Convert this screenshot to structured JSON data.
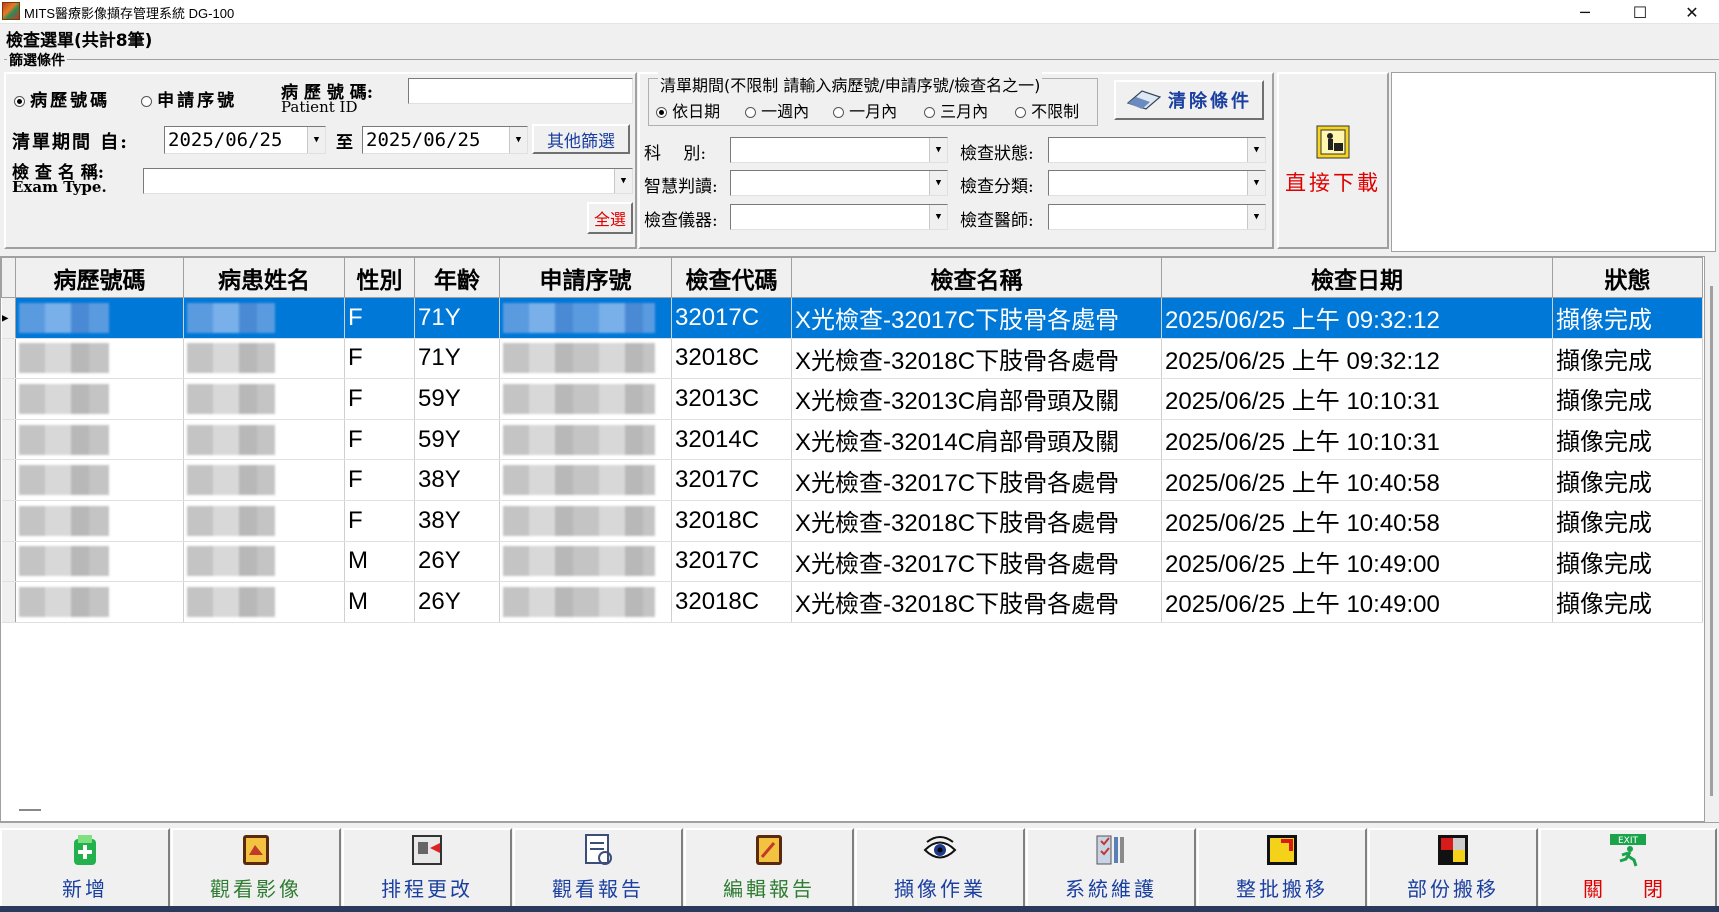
{
  "window": {
    "title": "MITS醫療影像擷存管理系統 DG-100",
    "minimize": "─",
    "maximize": "☐",
    "close": "✕"
  },
  "list_title": "檢查選單(共計8筆)",
  "filter": {
    "group_label": "篩選條件",
    "radio_patient": "病歷號碼",
    "radio_request": "申請序號",
    "patient_label": "病 歷 號 碼:",
    "patient_label_en": "Patient ID",
    "patient_value": "",
    "period_label": "清單期間 自:",
    "date_from": "2025/06/25",
    "to_label": "至",
    "date_to": "2025/06/25",
    "other_filter": "其他篩選",
    "exam_name_label": "檢 查 名 稱:",
    "exam_name_en": "Exam Type.",
    "exam_name_value": "",
    "select_all": "全選",
    "period_group_label": "清單期間(不限制 請輸入病歷號/申請序號/檢查名之一)",
    "period_options": [
      "依日期",
      "一週內",
      "一月內",
      "三月內",
      "不限制"
    ],
    "clear_button": "清除條件",
    "dept_label": "科　 別:",
    "ai_label": "智慧判讀:",
    "device_label": "檢查儀器:",
    "status_label": "檢查狀態:",
    "category_label": "檢查分類:",
    "doctor_label": "檢查醫師:",
    "download_label": "直接下載"
  },
  "table": {
    "headers": [
      "病歷號碼",
      "病患姓名",
      "性別",
      "年齡",
      "申請序號",
      "檢查代碼",
      "檢查名稱",
      "檢查日期",
      "狀態"
    ],
    "rows": [
      {
        "sex": "F",
        "age": "71Y",
        "code": "32017C",
        "name": "X光檢查-32017C下肢骨各處骨",
        "date": "2025/06/25 上午 09:32:12",
        "status": "擷像完成"
      },
      {
        "sex": "F",
        "age": "71Y",
        "code": "32018C",
        "name": "X光檢查-32018C下肢骨各處骨",
        "date": "2025/06/25 上午 09:32:12",
        "status": "擷像完成"
      },
      {
        "sex": "F",
        "age": "59Y",
        "code": "32013C",
        "name": "X光檢查-32013C肩部骨頭及關",
        "date": "2025/06/25 上午 10:10:31",
        "status": "擷像完成"
      },
      {
        "sex": "F",
        "age": "59Y",
        "code": "32014C",
        "name": "X光檢查-32014C肩部骨頭及關",
        "date": "2025/06/25 上午 10:10:31",
        "status": "擷像完成"
      },
      {
        "sex": "F",
        "age": "38Y",
        "code": "32017C",
        "name": "X光檢查-32017C下肢骨各處骨",
        "date": "2025/06/25 上午 10:40:58",
        "status": "擷像完成"
      },
      {
        "sex": "F",
        "age": "38Y",
        "code": "32018C",
        "name": "X光檢查-32018C下肢骨各處骨",
        "date": "2025/06/25 上午 10:40:58",
        "status": "擷像完成"
      },
      {
        "sex": "M",
        "age": "26Y",
        "code": "32017C",
        "name": "X光檢查-32017C下肢骨各處骨",
        "date": "2025/06/25 上午 10:49:00",
        "status": "擷像完成"
      },
      {
        "sex": "M",
        "age": "26Y",
        "code": "32018C",
        "name": "X光檢查-32018C下肢骨各處骨",
        "date": "2025/06/25 上午 10:49:00",
        "status": "擷像完成"
      }
    ],
    "selected_row": 0
  },
  "toolbar": {
    "buttons": [
      {
        "label": "新增",
        "icon": "add-icon"
      },
      {
        "label": "觀看影像",
        "icon": "view-image-icon"
      },
      {
        "label": "排程更改",
        "icon": "schedule-icon"
      },
      {
        "label": "觀看報告",
        "icon": "report-icon"
      },
      {
        "label": "編輯報告",
        "icon": "edit-report-icon"
      },
      {
        "label": "擷像作業",
        "icon": "eye-icon"
      },
      {
        "label": "系統維護",
        "icon": "tools-icon"
      },
      {
        "label": "整批搬移",
        "icon": "batch-move-icon"
      },
      {
        "label": "部份搬移",
        "icon": "partial-move-icon"
      },
      {
        "label": "關　閉",
        "icon": "exit-icon"
      }
    ],
    "exit_badge": "EXIT"
  },
  "colors": {
    "selection": "#0078d7",
    "toolbar_text": "#1a3fa0",
    "select_all_text": "#e00000",
    "download_text": "#e00000"
  }
}
